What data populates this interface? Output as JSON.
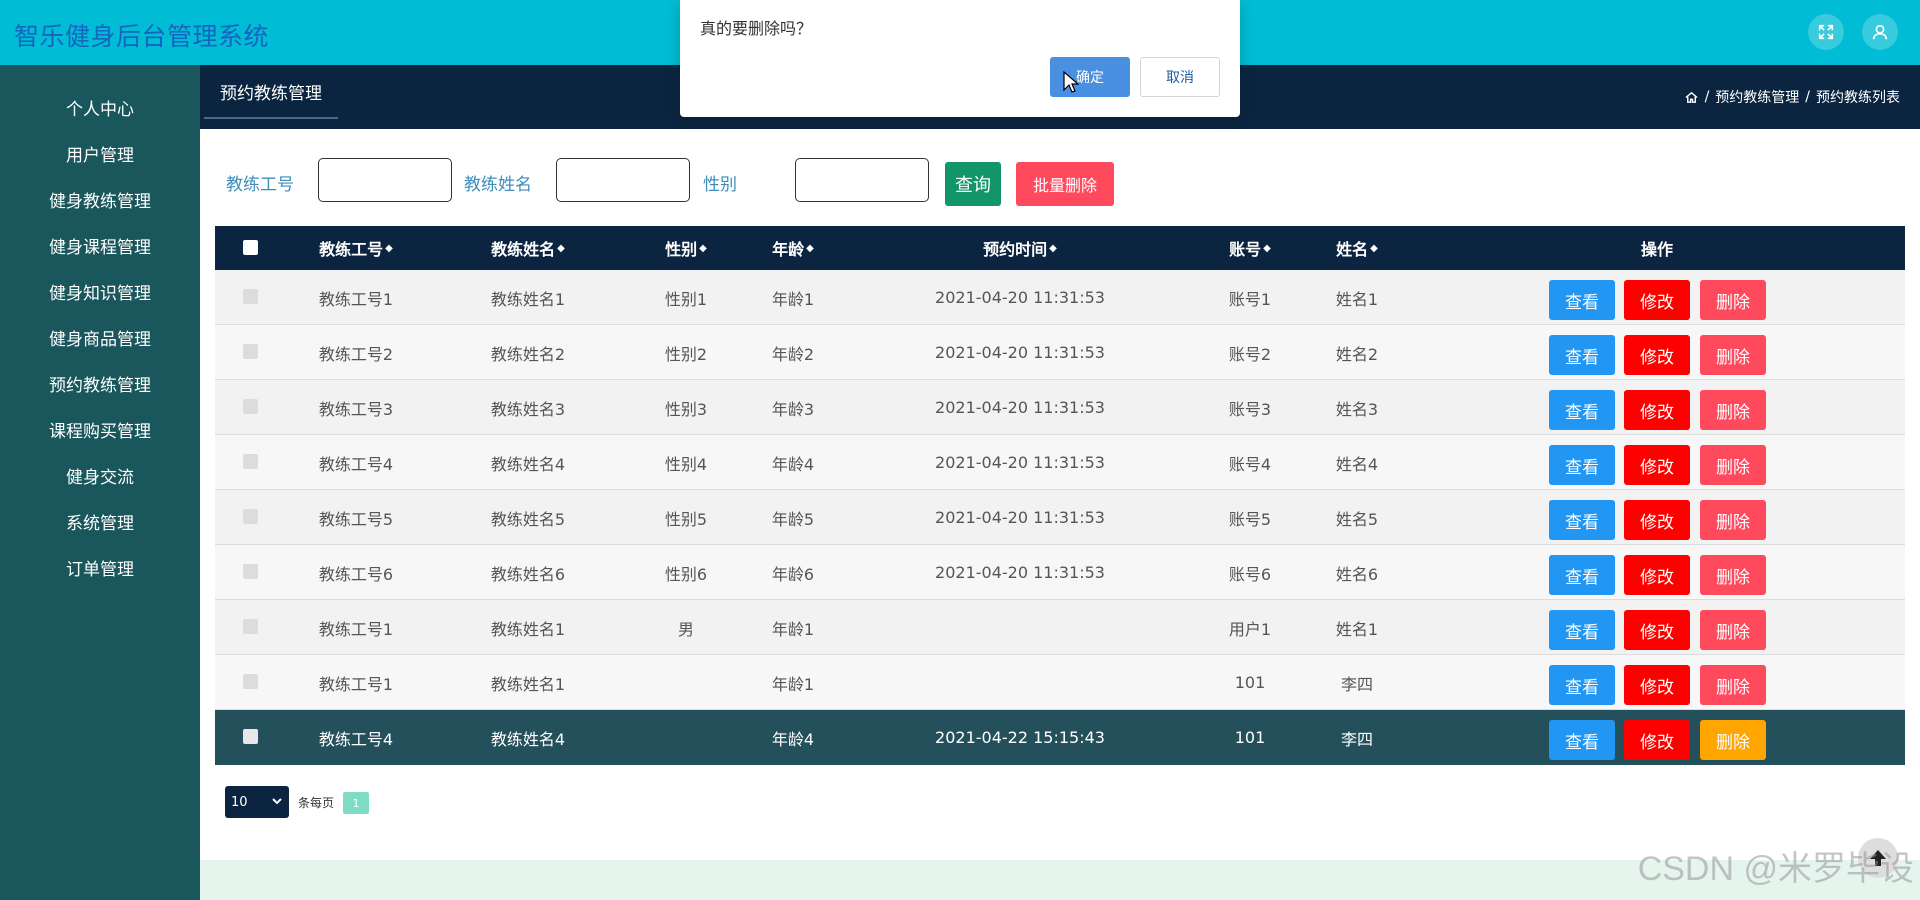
{
  "header": {
    "title": "智乐健身后台管理系统"
  },
  "sidebar": {
    "items": [
      {
        "label": "个人中心"
      },
      {
        "label": "用户管理"
      },
      {
        "label": "健身教练管理"
      },
      {
        "label": "健身课程管理"
      },
      {
        "label": "健身知识管理"
      },
      {
        "label": "健身商品管理"
      },
      {
        "label": "预约教练管理"
      },
      {
        "label": "课程购买管理"
      },
      {
        "label": "健身交流"
      },
      {
        "label": "系统管理"
      },
      {
        "label": "订单管理"
      }
    ]
  },
  "subbar": {
    "tab": "预约教练管理",
    "breadcrumb": {
      "sep1": "/",
      "level1": "预约教练管理",
      "sep2": "/",
      "level2": "预约教练列表"
    }
  },
  "search": {
    "coach_id_label": "教练工号",
    "coach_id_value": "",
    "coach_name_label": "教练姓名",
    "coach_name_value": "",
    "gender_label": "性别",
    "gender_value": "",
    "query_button": "查询",
    "batch_delete_button": "批量删除"
  },
  "table": {
    "headers": {
      "coach_id": "教练工号",
      "coach_name": "教练姓名",
      "gender": "性别",
      "age": "年龄",
      "booking_time": "预约时间",
      "account": "账号",
      "name": "姓名",
      "actions": "操作"
    },
    "rows": [
      {
        "coach_id": "教练工号1",
        "coach_name": "教练姓名1",
        "gender": "性别1",
        "age": "年龄1",
        "booking_time": "2021-04-20 11:31:53",
        "account": "账号1",
        "name": "姓名1"
      },
      {
        "coach_id": "教练工号2",
        "coach_name": "教练姓名2",
        "gender": "性别2",
        "age": "年龄2",
        "booking_time": "2021-04-20 11:31:53",
        "account": "账号2",
        "name": "姓名2"
      },
      {
        "coach_id": "教练工号3",
        "coach_name": "教练姓名3",
        "gender": "性别3",
        "age": "年龄3",
        "booking_time": "2021-04-20 11:31:53",
        "account": "账号3",
        "name": "姓名3"
      },
      {
        "coach_id": "教练工号4",
        "coach_name": "教练姓名4",
        "gender": "性别4",
        "age": "年龄4",
        "booking_time": "2021-04-20 11:31:53",
        "account": "账号4",
        "name": "姓名4"
      },
      {
        "coach_id": "教练工号5",
        "coach_name": "教练姓名5",
        "gender": "性别5",
        "age": "年龄5",
        "booking_time": "2021-04-20 11:31:53",
        "account": "账号5",
        "name": "姓名5"
      },
      {
        "coach_id": "教练工号6",
        "coach_name": "教练姓名6",
        "gender": "性别6",
        "age": "年龄6",
        "booking_time": "2021-04-20 11:31:53",
        "account": "账号6",
        "name": "姓名6"
      },
      {
        "coach_id": "教练工号1",
        "coach_name": "教练姓名1",
        "gender": "男",
        "age": "年龄1",
        "booking_time": "",
        "account": "用户1",
        "name": "姓名1"
      },
      {
        "coach_id": "教练工号1",
        "coach_name": "教练姓名1",
        "gender": "",
        "age": "年龄1",
        "booking_time": "",
        "account": "101",
        "name": "李四"
      },
      {
        "coach_id": "教练工号4",
        "coach_name": "教练姓名4",
        "gender": "",
        "age": "年龄4",
        "booking_time": "2021-04-22 15:15:43",
        "account": "101",
        "name": "李四"
      }
    ],
    "actions": {
      "view": "查看",
      "edit": "修改",
      "delete": "删除"
    }
  },
  "pagination": {
    "page_size": "10",
    "per_page_label": "条每页",
    "current_page": "1"
  },
  "dialog": {
    "message": "真的要删除吗？",
    "confirm": "确定",
    "cancel": "取消"
  },
  "watermark": "CSDN @米罗毕设",
  "colors": {
    "header_bg": "#00bcd4",
    "sidebar_bg": "#19575d",
    "navy": "#0b2540",
    "view_btn": "#2196f3",
    "edit_btn": "#ff0000",
    "delete_btn": "#ff4a5e",
    "delete_btn_active": "#ffa500",
    "query_btn": "#13956a",
    "highlight_row": "#24505c"
  }
}
